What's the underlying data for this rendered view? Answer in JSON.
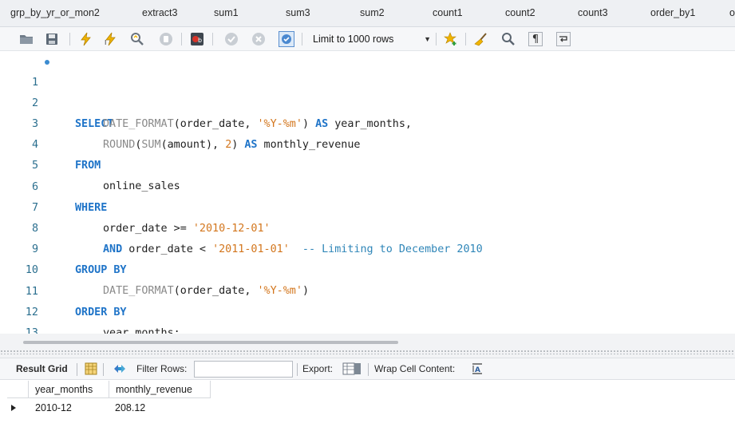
{
  "tabs": [
    "grp_by_yr_or_mon2",
    "extract3",
    "sum1",
    "sum3",
    "sum2",
    "count1",
    "count2",
    "count3",
    "order_by1",
    "o"
  ],
  "toolbar": {
    "limit_label": "Limit to 1000 rows",
    "icons": [
      "folder-open-icon",
      "save-icon",
      "execute-lightning-icon",
      "execute-current-lightning-icon",
      "explain-magnifier-icon",
      "stop-icon",
      "toggle-error-stop-icon",
      "commit-check-icon",
      "rollback-cancel-icon",
      "autocommit-toggle-icon",
      "add-snippet-star-icon",
      "beautify-broom-icon",
      "find-magnifier-icon",
      "invisible-chars-pilcrow-icon",
      "wrap-lines-icon"
    ]
  },
  "editor": {
    "line_numbers": [
      "1",
      "2",
      "3",
      "4",
      "5",
      "6",
      "7",
      "8",
      "9",
      "10",
      "11",
      "12",
      "13"
    ],
    "lines": {
      "l1": {
        "kw": "SELECT"
      },
      "l2": {
        "fn": "DATE_FORMAT",
        "p1": "(order_date, ",
        "str": "'%Y-%m'",
        "p2": ") ",
        "as": "AS",
        "p3": " year_months,"
      },
      "l3": {
        "fn": "ROUND",
        "p1": "(",
        "fn2": "SUM",
        "p2": "(amount), ",
        "num": "2",
        "p3": ") ",
        "as": "AS",
        "p4": " monthly_revenue"
      },
      "l4": {
        "kw": "FROM"
      },
      "l5": {
        "text": "online_sales"
      },
      "l6": {
        "kw": "WHERE"
      },
      "l7": {
        "p1": "order_date >= ",
        "str": "'2010-12-01'"
      },
      "l8": {
        "kw": "AND",
        "p1": " order_date < ",
        "str": "'2011-01-01'",
        "cm": "  -- Limiting to December 2010"
      },
      "l9": {
        "kw": "GROUP BY"
      },
      "l10": {
        "fn": "DATE_FORMAT",
        "p1": "(order_date, ",
        "str": "'%Y-%m'",
        "p2": ")"
      },
      "l11": {
        "kw": "ORDER BY"
      },
      "l12": {
        "text": "year_months;"
      }
    }
  },
  "result_toolbar": {
    "result_grid": "Result Grid",
    "filter_rows": "Filter Rows:",
    "filter_value": "",
    "export": "Export:",
    "wrap": "Wrap Cell Content:"
  },
  "result_grid": {
    "columns": [
      "year_months",
      "monthly_revenue"
    ],
    "rows": [
      [
        "2010-12",
        "208.12"
      ]
    ]
  }
}
